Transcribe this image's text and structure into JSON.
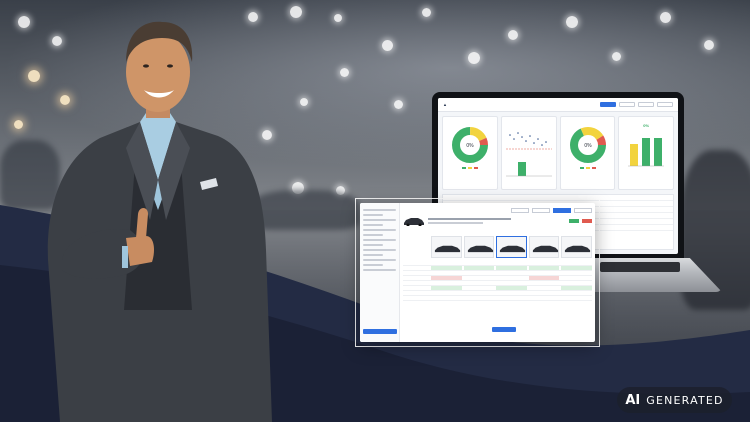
{
  "badge": {
    "ai": "AI",
    "label": "GENERATED"
  },
  "colors": {
    "navy_wave": "#1e2640",
    "accent_blue": "#2f6fe0",
    "chart_green": "#3eb06a",
    "chart_yellow": "#f2d33e",
    "chart_red": "#e05a4f"
  },
  "laptop_dashboard": {
    "donut_left_value": "0%",
    "donut_right_value": "0%",
    "bar_card_value": "0%",
    "bar_values": [
      0.55,
      0.55,
      0.55
    ]
  }
}
